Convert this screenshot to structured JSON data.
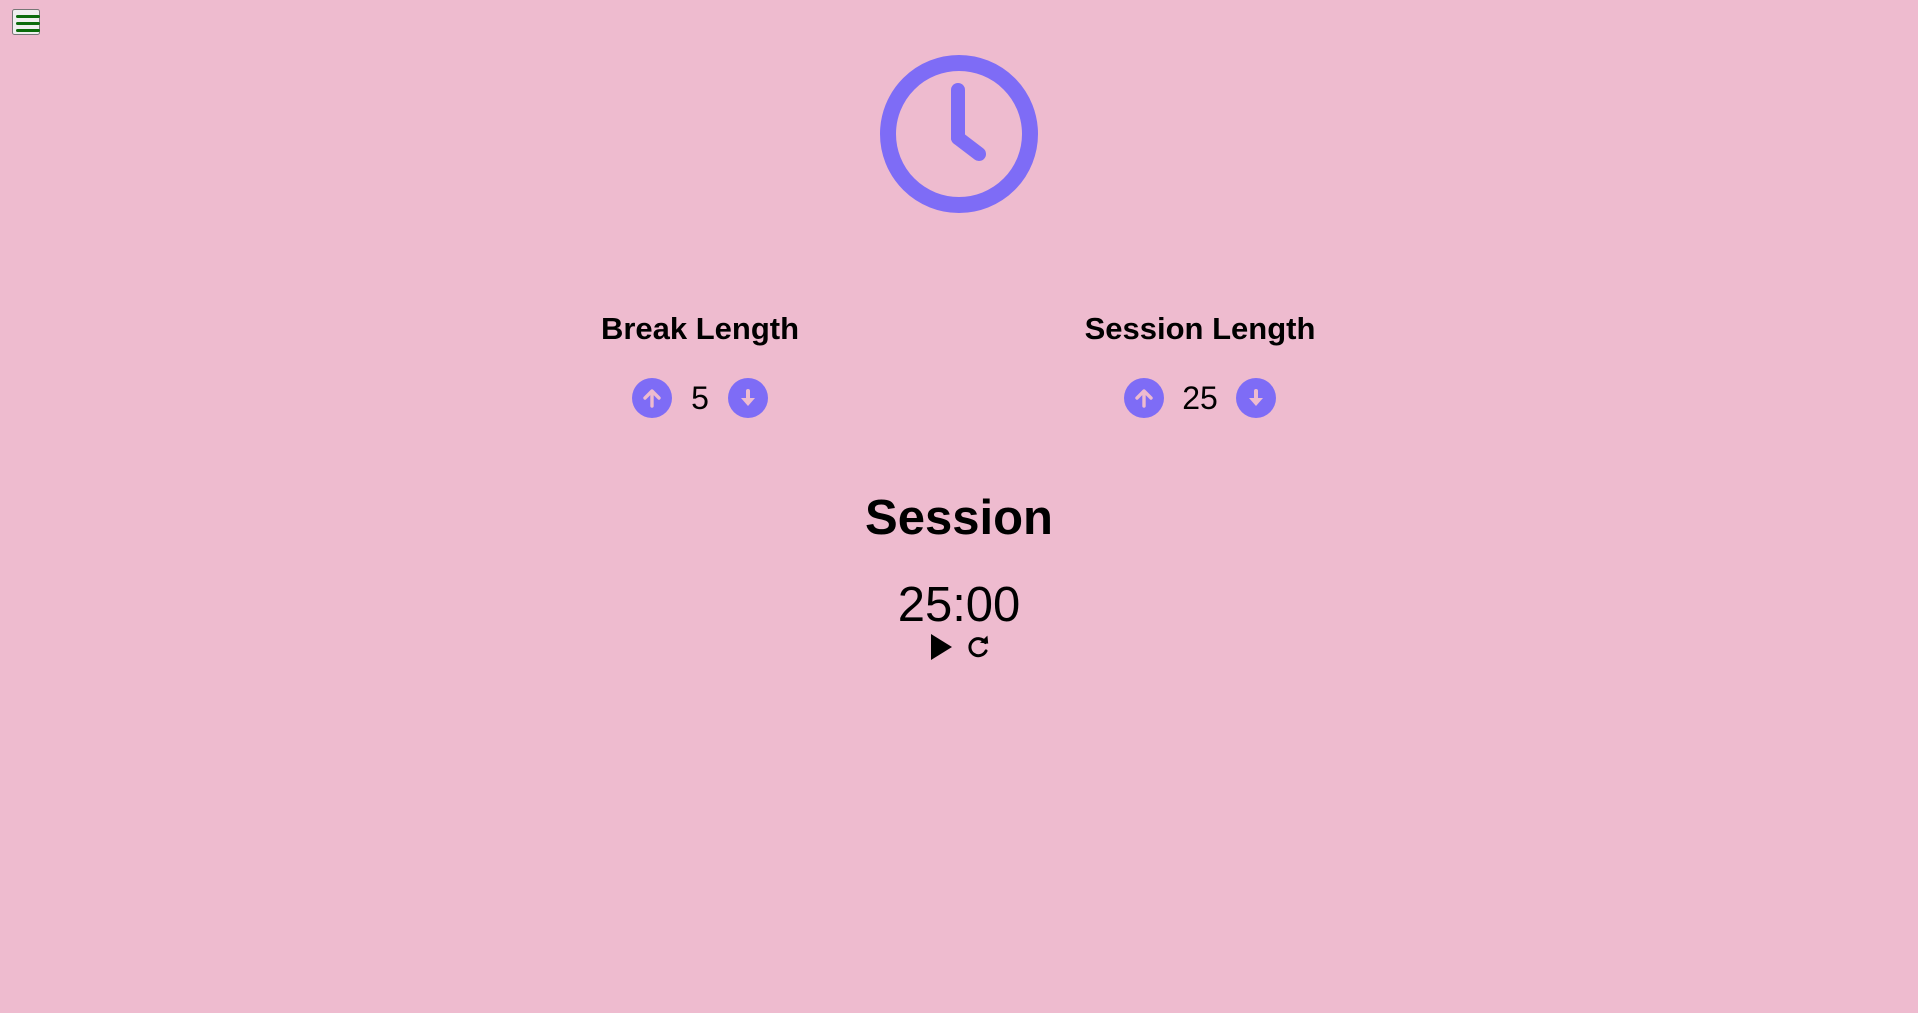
{
  "icons": {
    "menu": "hamburger-menu-icon",
    "clock": "clock-icon",
    "increment": "arrow-up-circle-icon",
    "decrement": "arrow-down-circle-icon",
    "play": "play-icon",
    "reset": "refresh-icon"
  },
  "colors": {
    "background": "#EEBBCF",
    "accent": "#7E6CF6",
    "menu": "#0B6B0B"
  },
  "break": {
    "label": "Break Length",
    "value": "5"
  },
  "session": {
    "label": "Session Length",
    "value": "25"
  },
  "timer": {
    "label": "Session",
    "time_left": "25:00"
  }
}
